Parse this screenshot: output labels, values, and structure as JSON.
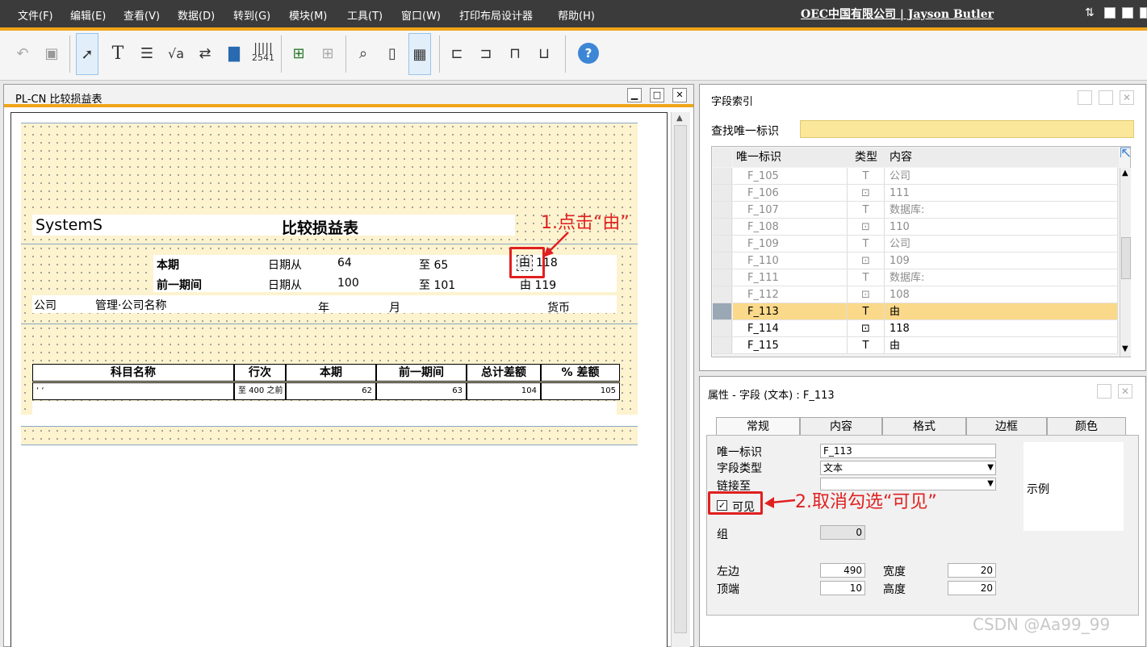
{
  "menubar": {
    "items": [
      "文件(F)",
      "编辑(E)",
      "查看(V)",
      "数据(D)",
      "转到(G)",
      "模块(M)",
      "工具(T)",
      "窗口(W)",
      "打印布局设计器",
      "帮助(H)"
    ],
    "company": "OEC中国有限公司 | Jayson Butler",
    "accent_color": "#f0a418"
  },
  "toolbar": {
    "icons": [
      "undo-icon",
      "save-icon",
      "pointer-icon",
      "text-icon",
      "field-icon",
      "formula-icon",
      "database-icon",
      "picture-icon",
      "barcode-icon",
      "tree-icon",
      "grid-icon",
      "preview-icon",
      "new-page-icon",
      "table-icon",
      "align-left-icon",
      "align-right-icon",
      "align-top-icon",
      "align-bottom-icon",
      "help-icon"
    ],
    "barcode_label": "2541"
  },
  "left_window": {
    "title": "PL-CN 比较损益表",
    "report": {
      "header_left": "SystemS",
      "header_title": "比较损益表",
      "current_period": "本期",
      "prev_period": "前一期间",
      "date_from": "日期从",
      "from_val_1": "64",
      "to_1": "至 65",
      "from_val_2": "100",
      "to_2": "至 101",
      "by_val_1": "118",
      "by_2": "由 119",
      "by_icon": "由",
      "company": "公司",
      "admin_name": "管理·公司名称",
      "year": "年",
      "month": "月",
      "currency": "货币",
      "columns": [
        "科目名称",
        "行次",
        "本期",
        "前一期间",
        "总计差额",
        "% 差额"
      ],
      "row": [
        "‘ ‘",
        "至 400 之前",
        "62",
        "63",
        "104",
        "105"
      ]
    }
  },
  "field_index": {
    "title": "字段索引",
    "search_label": "查找唯一标识",
    "search_value": "",
    "columns": [
      "唯一标识",
      "类型",
      "内容"
    ],
    "rows": [
      {
        "id": "F_105",
        "type": "T",
        "content": "公司",
        "dim": true
      },
      {
        "id": "F_106",
        "type": "⊡",
        "content": "111",
        "dim": true
      },
      {
        "id": "F_107",
        "type": "T",
        "content": "数据库:",
        "dim": true
      },
      {
        "id": "F_108",
        "type": "⊡",
        "content": "110",
        "dim": true
      },
      {
        "id": "F_109",
        "type": "T",
        "content": "公司",
        "dim": true
      },
      {
        "id": "F_110",
        "type": "⊡",
        "content": "109",
        "dim": true
      },
      {
        "id": "F_111",
        "type": "T",
        "content": "数据库:",
        "dim": true
      },
      {
        "id": "F_112",
        "type": "⊡",
        "content": "108",
        "dim": true
      },
      {
        "id": "F_113",
        "type": "T",
        "content": "由",
        "selected": true
      },
      {
        "id": "F_114",
        "type": "⊡",
        "content": "118"
      },
      {
        "id": "F_115",
        "type": "T",
        "content": "由"
      }
    ]
  },
  "properties": {
    "title": "属性 - 字段 (文本) : F_113",
    "tabs": [
      "常规",
      "内容",
      "格式",
      "边框",
      "颜色"
    ],
    "unique_id_label": "唯一标识",
    "unique_id_value": "F_113",
    "field_type_label": "字段类型",
    "field_type_value": "文本",
    "link_to_label": "链接至",
    "link_to_value": "",
    "visible_label": "可见",
    "visible_checked": true,
    "group_label": "组",
    "group_value": "0",
    "left_label": "左边",
    "left_value": "490",
    "width_label": "宽度",
    "width_value": "20",
    "top_label": "顶端",
    "top_value": "10",
    "height_label": "高度",
    "height_value": "20",
    "example_label": "示例"
  },
  "annotations": {
    "step1": "1.点击“由”",
    "step2": "2.取消勾选“可见”"
  },
  "watermark": "CSDN @Aa99_99"
}
